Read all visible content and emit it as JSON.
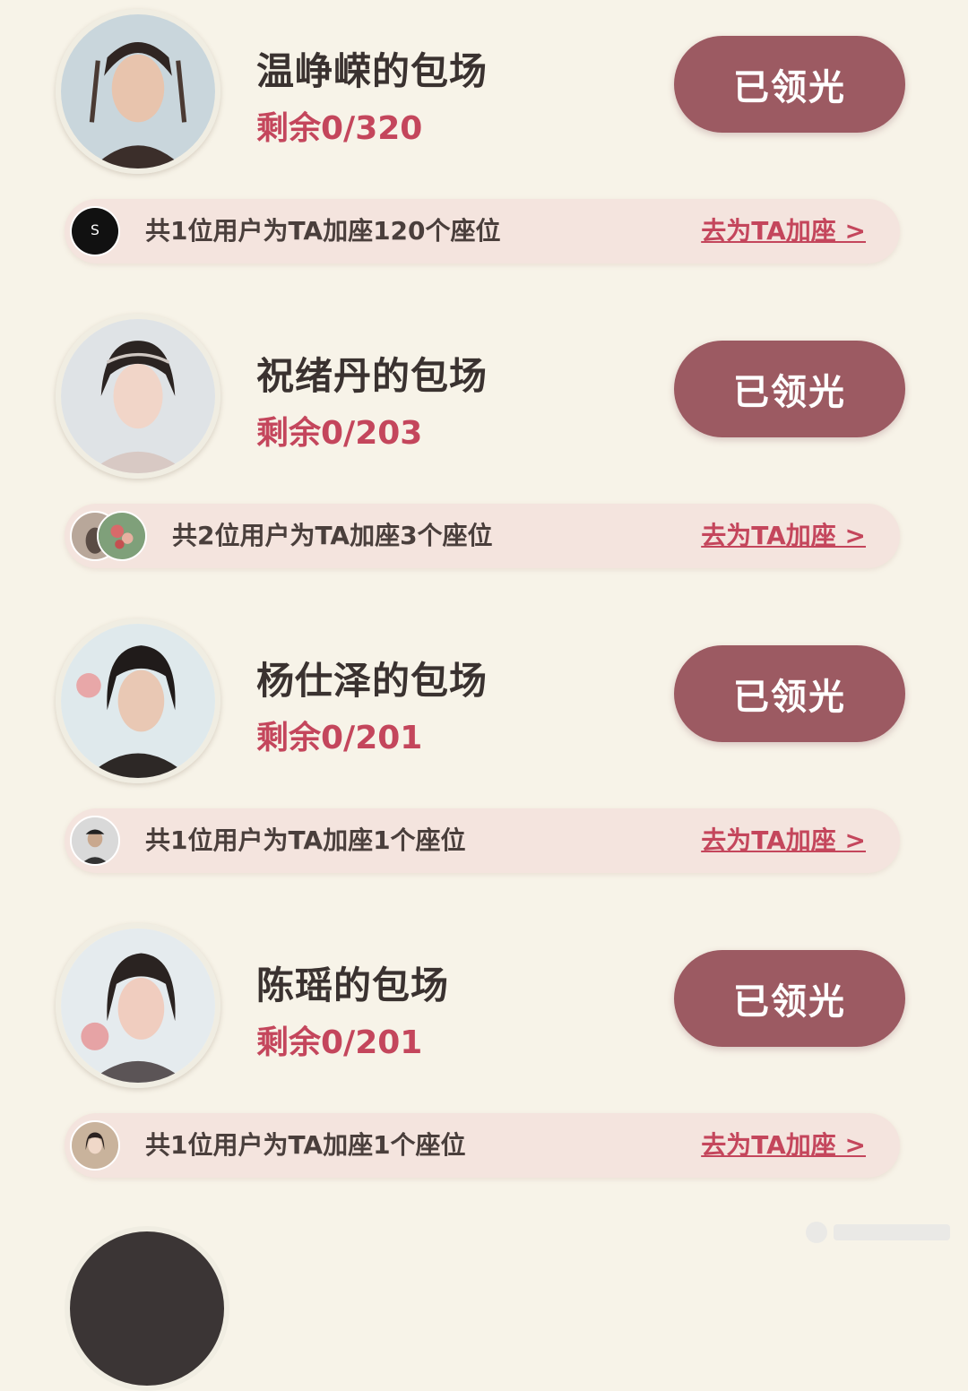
{
  "cards": [
    {
      "title": "温峥嵘的包场",
      "remaining": "剩余0/320",
      "button": "已领光",
      "bar_text": "共1位用户为TA加座120个座位",
      "link": "去为TA加座 >"
    },
    {
      "title": "祝绪丹的包场",
      "remaining": "剩余0/203",
      "button": "已领光",
      "bar_text": "共2位用户为TA加座3个座位",
      "link": "去为TA加座 >"
    },
    {
      "title": "杨仕泽的包场",
      "remaining": "剩余0/201",
      "button": "已领光",
      "bar_text": "共1位用户为TA加座1个座位",
      "link": "去为TA加座 >"
    },
    {
      "title": "陈瑶的包场",
      "remaining": "剩余0/201",
      "button": "已领光",
      "bar_text": "共1位用户为TA加座1个座位",
      "link": "去为TA加座 >"
    }
  ],
  "colors": {
    "background": "#f7f3e8",
    "button": "#9c5a62",
    "accent": "#c4465c",
    "bar": "#f4e4de"
  }
}
